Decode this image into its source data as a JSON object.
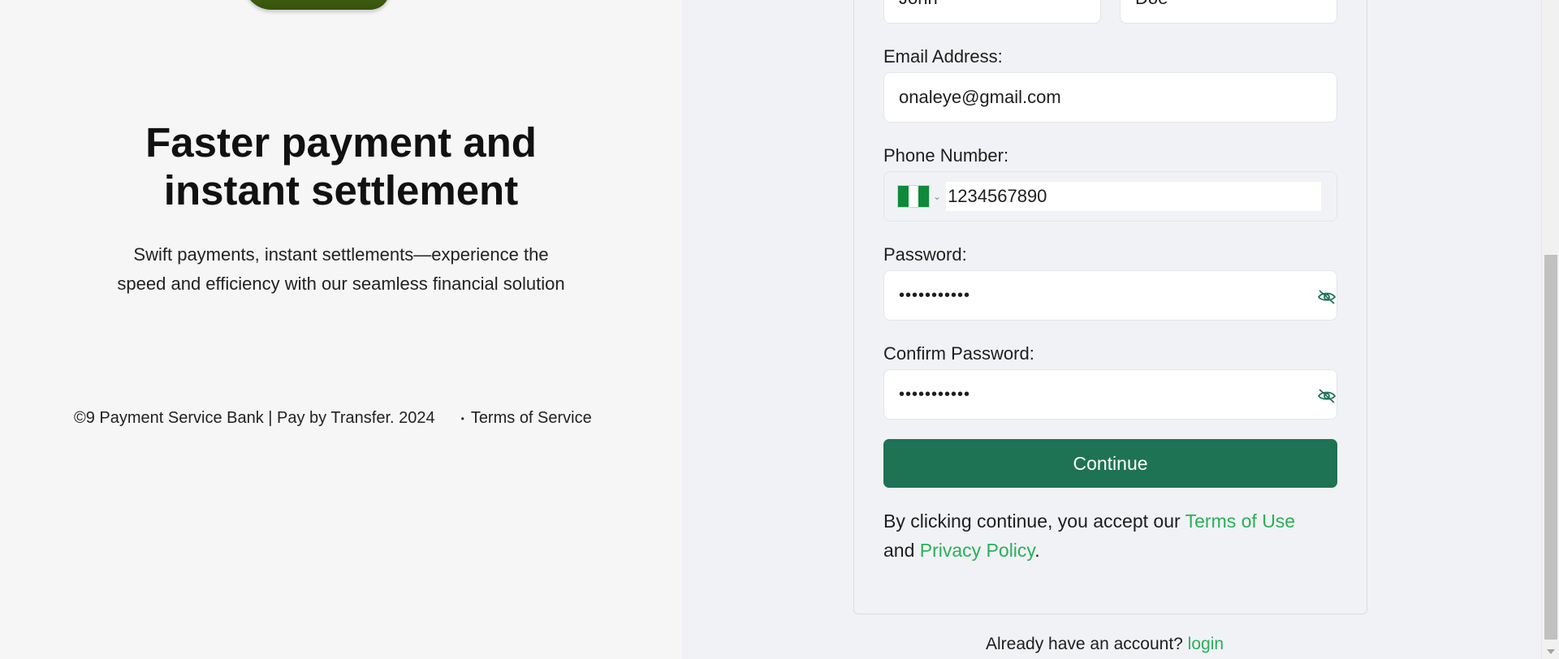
{
  "left": {
    "headline_line1": "Faster payment and",
    "headline_line2": "instant settlement",
    "subline_line1": "Swift payments, instant settlements—experience the",
    "subline_line2": "speed and efficiency with our seamless financial solution",
    "copyright": "©9 Payment Service Bank | Pay by Transfer. 2024",
    "bullet": "•",
    "terms_of_service": "Terms of Service"
  },
  "form": {
    "first_name_value": "John",
    "last_name_value": "Doe",
    "email_label": "Email Address:",
    "email_value": "onaleye@gmail.com",
    "phone_label": "Phone Number:",
    "phone_country_flag": "nigeria-flag",
    "phone_value": "1234567890",
    "password_label": "Password:",
    "password_value": "•••••••••••",
    "confirm_password_label": "Confirm Password:",
    "confirm_password_value": "•••••••••••",
    "continue_label": "Continue",
    "consent_prefix": "By clicking continue, you accept our ",
    "terms_of_use": "Terms of Use",
    "consent_and": "and ",
    "privacy_policy": "Privacy Policy",
    "consent_suffix": "."
  },
  "footer": {
    "have_account": "Already have an account? ",
    "login": "login"
  },
  "colors": {
    "primary_button": "#1e7354",
    "link": "#29b05a"
  }
}
